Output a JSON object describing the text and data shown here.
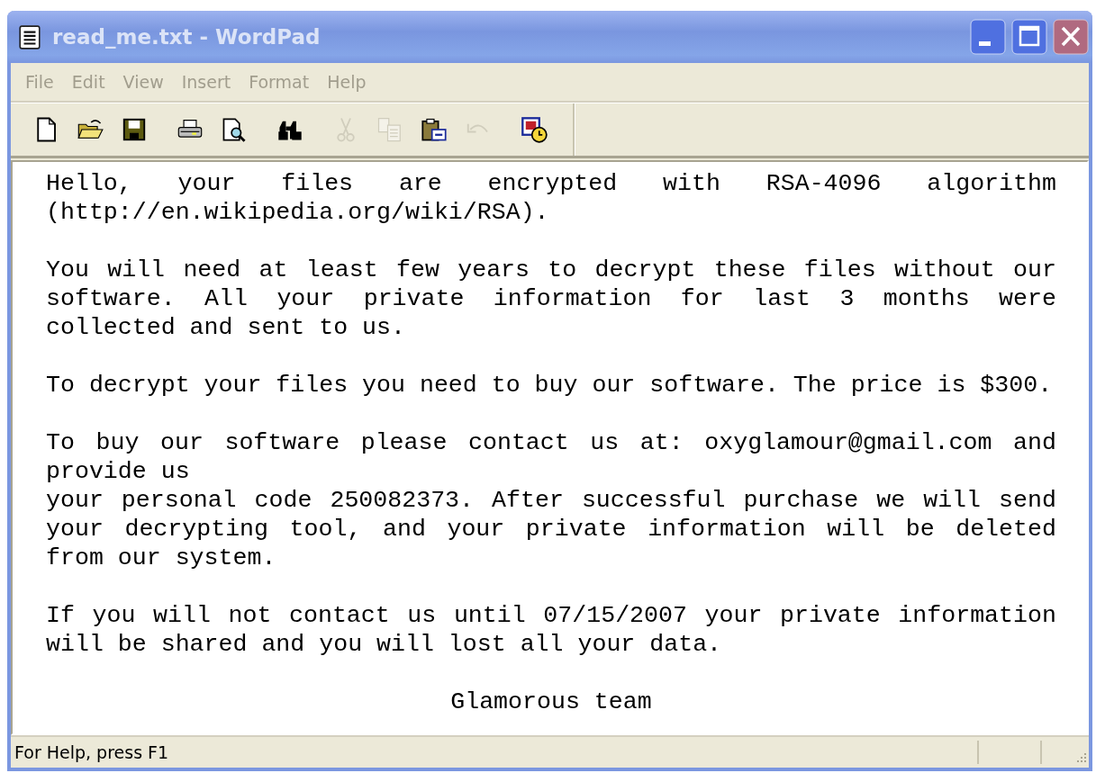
{
  "window": {
    "title": "read_me.txt - WordPad",
    "active": false
  },
  "menu": [
    {
      "label": "File"
    },
    {
      "label": "Edit"
    },
    {
      "label": "View"
    },
    {
      "label": "Insert"
    },
    {
      "label": "Format"
    },
    {
      "label": "Help"
    }
  ],
  "toolbar": [
    [
      {
        "kind": "new",
        "disabled": false
      },
      {
        "kind": "open",
        "disabled": false
      },
      {
        "kind": "save",
        "disabled": false
      }
    ],
    [
      {
        "kind": "print",
        "disabled": false
      },
      {
        "kind": "preview",
        "disabled": false
      }
    ],
    [
      {
        "kind": "find",
        "disabled": false
      }
    ],
    [
      {
        "kind": "cut",
        "disabled": true
      },
      {
        "kind": "copy",
        "disabled": true
      },
      {
        "kind": "paste",
        "disabled": false
      },
      {
        "kind": "undo",
        "disabled": true
      }
    ],
    [
      {
        "kind": "datetime",
        "disabled": false
      }
    ]
  ],
  "document": {
    "paragraphs": [
      {
        "kind": "body",
        "lines": [
          "Hello, your files are encrypted with RSA-4096 algorithm (http://en.wikipedia.org/wiki/RSA)."
        ]
      },
      {
        "kind": "body",
        "lines": [
          "You will need at least few years to decrypt these files without our software. All your private information for last 3 months were collected and sent to us."
        ]
      },
      {
        "kind": "body",
        "lines": [
          "To decrypt your files you need to buy our software. The price is $300."
        ]
      },
      {
        "kind": "body",
        "lines": [
          "To buy our software please contact us at: oxyglamour@gmail.com and provide us",
          "your personal code 250082373. After successful purchase we will send your decrypting tool, and your private information will be deleted from our system."
        ]
      },
      {
        "kind": "body",
        "lines": [
          "If you will not contact us until 07/15/2007 your private information will be shared and you will lost all your data."
        ]
      },
      {
        "kind": "signature",
        "lines": [
          "Glamorous team"
        ]
      }
    ]
  },
  "status_bar": {
    "text": "For Help, press F1"
  }
}
